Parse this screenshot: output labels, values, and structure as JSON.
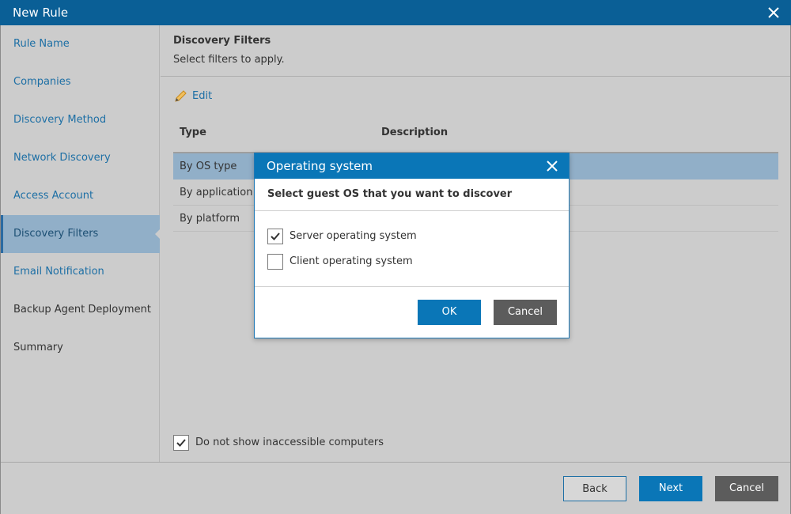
{
  "window": {
    "title": "New Rule",
    "close_icon": "close-icon"
  },
  "sidebar": {
    "items": [
      {
        "label": "Rule Name",
        "state": "link"
      },
      {
        "label": "Companies",
        "state": "link"
      },
      {
        "label": "Discovery Method",
        "state": "link"
      },
      {
        "label": "Network Discovery",
        "state": "link"
      },
      {
        "label": "Access Account",
        "state": "link"
      },
      {
        "label": "Discovery Filters",
        "state": "active"
      },
      {
        "label": "Email Notification",
        "state": "link"
      },
      {
        "label": "Backup Agent Deployment",
        "state": "plain"
      },
      {
        "label": "Summary",
        "state": "plain"
      }
    ]
  },
  "main": {
    "title": "Discovery Filters",
    "subtitle": "Select filters to apply.",
    "edit_label": "Edit",
    "table": {
      "columns": [
        "Type",
        "Description"
      ],
      "rows": [
        {
          "type": "By OS type",
          "selected": true
        },
        {
          "type": "By application",
          "selected": false
        },
        {
          "type": "By platform",
          "selected": false
        }
      ]
    },
    "hide_inaccessible": {
      "label": "Do not show inaccessible computers",
      "checked": true
    }
  },
  "footer": {
    "back_label": "Back",
    "next_label": "Next",
    "cancel_label": "Cancel"
  },
  "dialog": {
    "title": "Operating system",
    "subtitle": "Select guest OS that you want to discover",
    "options": [
      {
        "label": "Server operating system",
        "checked": true
      },
      {
        "label": "Client operating system",
        "checked": false
      }
    ],
    "ok_label": "OK",
    "cancel_label": "Cancel"
  },
  "colors": {
    "title_bar": "#0a5f96",
    "dialog_header": "#0a76b7",
    "primary_button": "#0a76b7",
    "selection": "#91afc8",
    "link": "#1d6fa5"
  }
}
